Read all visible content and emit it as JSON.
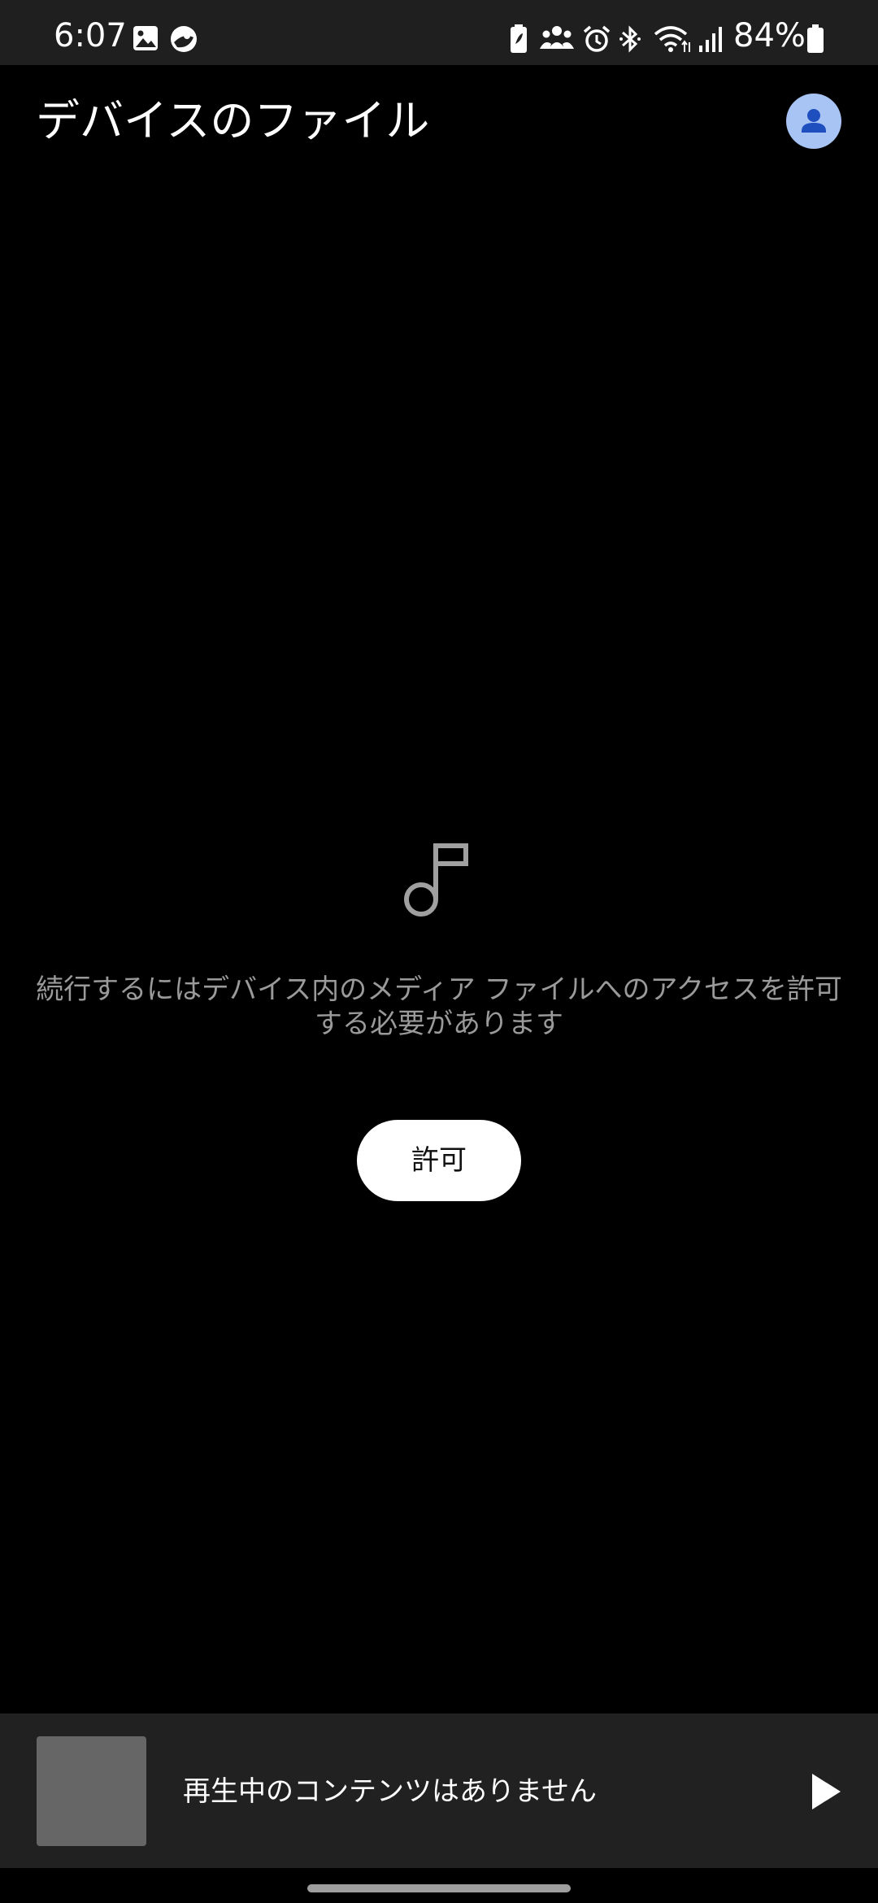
{
  "status_bar": {
    "time": "6:07",
    "battery_percent": "84%",
    "icons": [
      "image-icon",
      "app-notification-icon",
      "battery-saver-icon",
      "group-icon",
      "alarm-icon",
      "bluetooth-icon",
      "wifi-icon",
      "signal-icon",
      "battery-icon"
    ]
  },
  "header": {
    "title": "デバイスのファイル",
    "avatar_icon": "account-icon",
    "avatar_color": "#a8c4f5"
  },
  "empty_state": {
    "icon": "music-note-icon",
    "message_line1": "続行するにはデバイス内のメディア ファイルへのアクセスを許可",
    "message_line2": "する必要があります",
    "allow_button_label": "許可"
  },
  "mini_player": {
    "now_playing_text": "再生中のコンテンツはありません",
    "play_icon": "play-icon"
  }
}
